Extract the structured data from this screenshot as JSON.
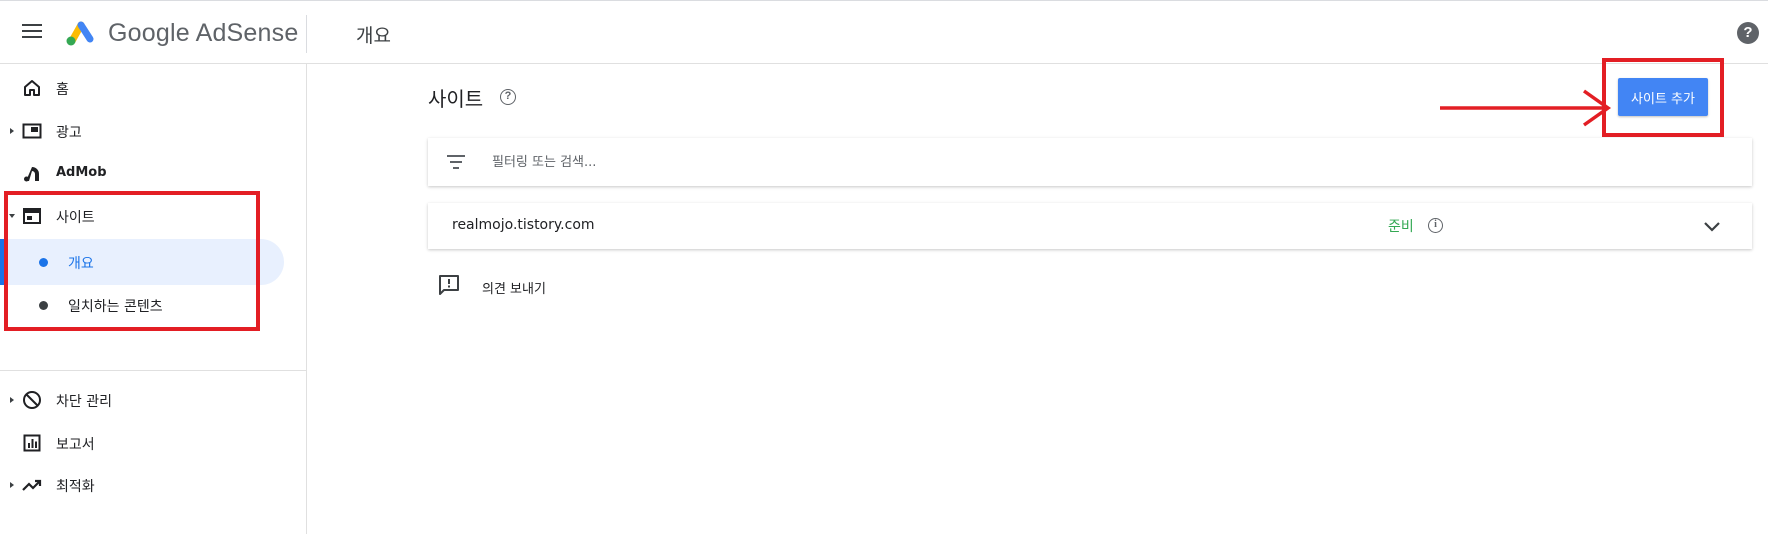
{
  "header": {
    "app_name": "Google AdSense",
    "page_title": "개요",
    "help_glyph": "?"
  },
  "sidebar": {
    "items": [
      {
        "label": "홈",
        "icon": "home-icon"
      },
      {
        "label": "광고",
        "icon": "ads-icon"
      },
      {
        "label": "AdMob",
        "icon": "admob-icon"
      },
      {
        "label": "사이트",
        "icon": "sites-icon"
      },
      {
        "label": "차단 관리",
        "icon": "block-icon"
      },
      {
        "label": "보고서",
        "icon": "reports-icon"
      },
      {
        "label": "최적화",
        "icon": "optimization-icon"
      }
    ],
    "sites_subitems": [
      {
        "label": "개요",
        "active": true
      },
      {
        "label": "일치하는 콘텐츠",
        "active": false
      }
    ]
  },
  "main": {
    "heading": "사이트",
    "heading_help_glyph": "?",
    "add_site_label": "사이트 추가",
    "filter_placeholder": "필터링 또는 검색...",
    "sites": [
      {
        "domain": "realmojo.tistory.com",
        "status": "준비",
        "status_info_glyph": "i"
      }
    ],
    "feedback_label": "의견 보내기"
  },
  "colors": {
    "accent": "#1a73e8",
    "button": "#4285f4",
    "status_ready": "#34a853",
    "annotation_red": "#e31e24",
    "active_bg": "#e8f0fe"
  }
}
